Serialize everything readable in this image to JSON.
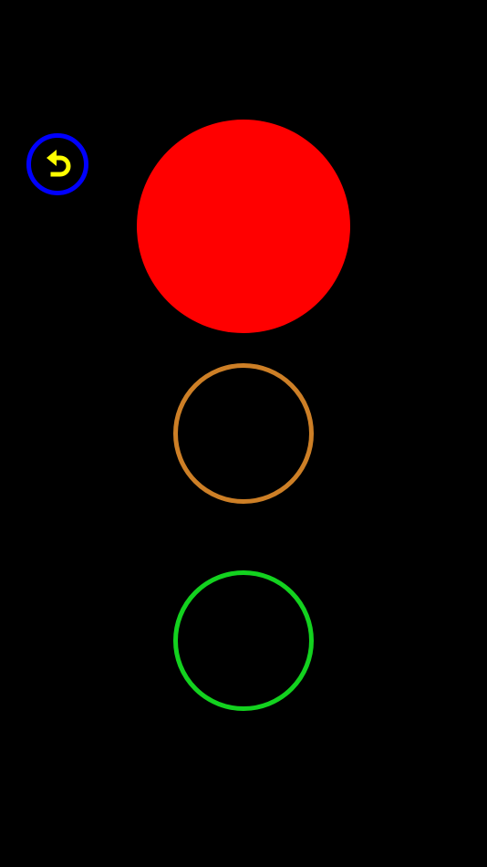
{
  "screen": {
    "background_color": "#000000"
  },
  "back_button": {
    "icon": "undo-arrow-icon",
    "ring_color": "#0000ff",
    "icon_color": "#ffff00"
  },
  "traffic_light": {
    "lights": [
      {
        "name": "red",
        "state": "on",
        "color": "#ff0000"
      },
      {
        "name": "orange",
        "state": "off",
        "color": "#cd7f26"
      },
      {
        "name": "green",
        "state": "off",
        "color": "#13d21f"
      }
    ]
  }
}
